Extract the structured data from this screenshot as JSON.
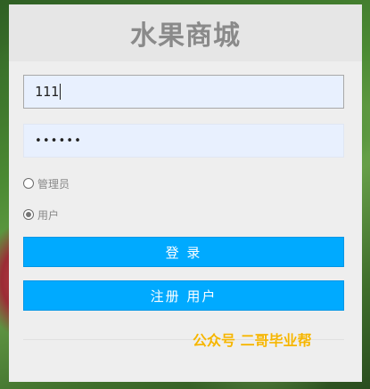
{
  "header": {
    "title": "水果商城"
  },
  "form": {
    "username": {
      "value": "111"
    },
    "password": {
      "masked_value": "••••••"
    },
    "roles": [
      {
        "label": "管理员",
        "checked": false
      },
      {
        "label": "用户",
        "checked": true
      }
    ],
    "login_label": "登 录",
    "register_label": "注册 用户"
  },
  "watermark": {
    "text": "公众号 二哥毕业帮"
  },
  "colors": {
    "accent": "#00aaff",
    "watermark": "#f5b500",
    "panel": "#eeeeee"
  }
}
